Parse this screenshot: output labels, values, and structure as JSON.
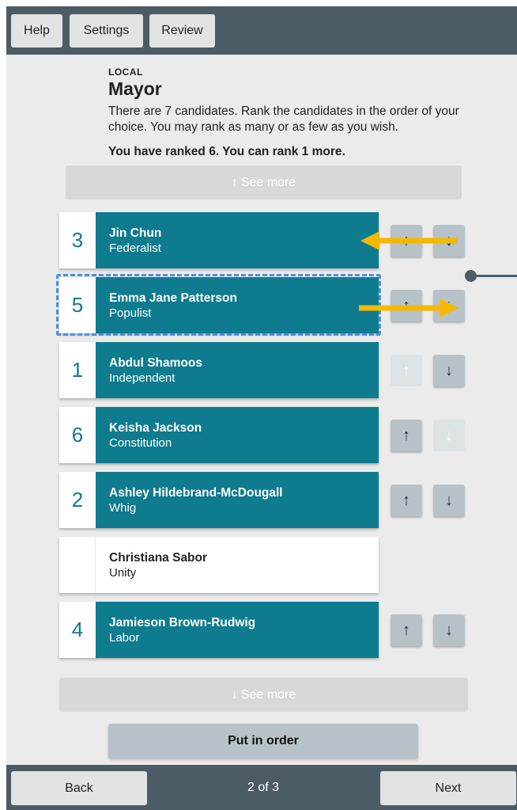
{
  "topbar": {
    "help": "Help",
    "settings": "Settings",
    "review": "Review"
  },
  "contest": {
    "section": "LOCAL",
    "title": "Mayor",
    "description": "There are 7 candidates. Rank the candidates in the order of your choice. You may rank as many or as few as you wish.",
    "ranked_status": "You have ranked 6. You can rank 1 more."
  },
  "see_more": {
    "arrow_up": "↑",
    "arrow_down": "↓",
    "label": "See more"
  },
  "candidates": [
    {
      "rank": "3",
      "name": "Jin Chun",
      "party": "Federalist"
    },
    {
      "rank": "5",
      "name": "Emma Jane Patterson",
      "party": "Populist"
    },
    {
      "rank": "1",
      "name": "Abdul Shamoos",
      "party": "Independent"
    },
    {
      "rank": "6",
      "name": "Keisha Jackson",
      "party": "Constitution"
    },
    {
      "rank": "2",
      "name": "Ashley Hildebrand-McDougall",
      "party": "Whig"
    },
    {
      "rank": "",
      "name": "Christiana Sabor",
      "party": "Unity"
    },
    {
      "rank": "4",
      "name": "Jamieson Brown-Rudwig",
      "party": "Labor"
    }
  ],
  "arrows": {
    "up": "↑",
    "down": "↓"
  },
  "put_in_order": "Put in order",
  "nav": {
    "back": "Back",
    "page": "2 of 3",
    "next": "Next"
  },
  "colors": {
    "bar": "#4c5c66",
    "accent": "#0e7b8e",
    "annotation_arrow": "#f5b800",
    "focus": "#4a8fe8"
  }
}
